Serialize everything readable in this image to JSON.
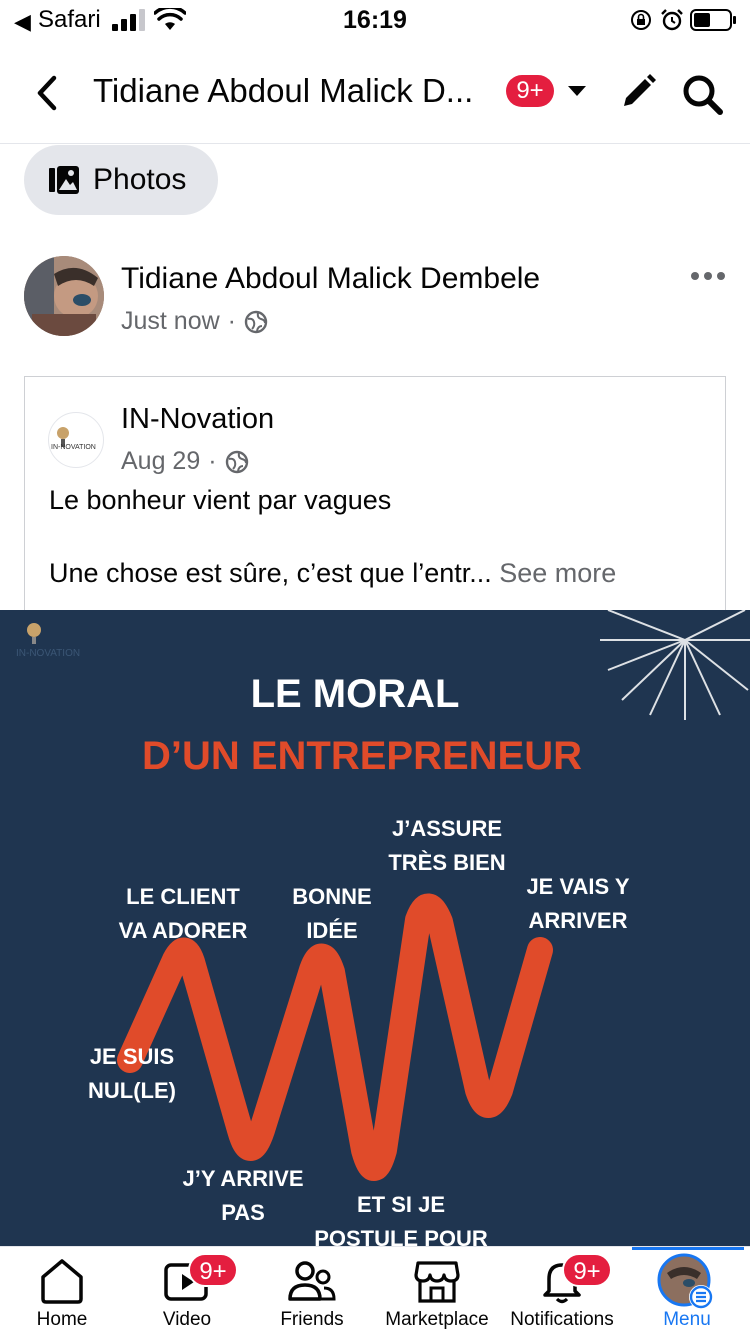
{
  "status_bar": {
    "back_app": "Safari",
    "time": "16:19"
  },
  "header": {
    "title": "Tidiane Abdoul Malick D...",
    "badge": "9+"
  },
  "chip": {
    "label": "Photos"
  },
  "post": {
    "author": "Tidiane Abdoul Malick Dembele",
    "time": "Just now",
    "separator": "·",
    "privacy_icon": "globe-icon"
  },
  "shared": {
    "page_name": "IN-Novation",
    "date": "Aug 29",
    "separator": "·",
    "logo_text": "IN-NOVATION",
    "line1": "Le bonheur vient par vagues",
    "line2": "Une chose est sûre, c’est que l’entr...",
    "see_more": "See more"
  },
  "image": {
    "brand": "IN-NOVATION",
    "title1": "LE MORAL",
    "title2": "D’UN ENTREPRENEUR",
    "labels": {
      "client_1": "LE CLIENT",
      "client_2": "VA ADORER",
      "bonne_1": "BONNE",
      "bonne_2": "IDÉE",
      "assure_1": "J’ASSURE",
      "assure_2": "TRÈS BIEN",
      "vais_1": "JE VAIS Y",
      "vais_2": "ARRIVER",
      "nul_1": "JE SUIS",
      "nul_2": "NUL(LE)",
      "arrive_1": "J’Y ARRIVE",
      "arrive_2": "PAS",
      "etsi_1": "ET SI JE",
      "etsi_2": "POSTULE POUR"
    },
    "colors": {
      "background": "#1f3550",
      "accent": "#e04b2a"
    }
  },
  "tabs": [
    {
      "label": "Home",
      "icon": "home-icon"
    },
    {
      "label": "Video",
      "icon": "video-icon",
      "badge": "9+"
    },
    {
      "label": "Friends",
      "icon": "friends-icon"
    },
    {
      "label": "Marketplace",
      "icon": "marketplace-icon"
    },
    {
      "label": "Notifications",
      "icon": "bell-icon",
      "badge": "9+"
    },
    {
      "label": "Menu",
      "icon": "menu-icon",
      "active": true
    }
  ]
}
